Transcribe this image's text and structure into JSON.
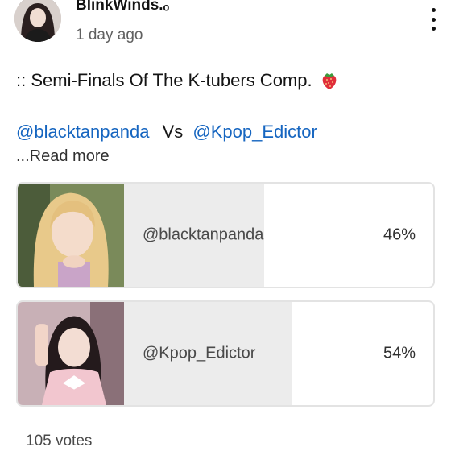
{
  "post": {
    "author": "BlinkWinds.ₒ",
    "timestamp": "1 day ago",
    "line1": ":: Semi-Finals Of The K-tubers Comp.",
    "emoji": "strawberry-icon",
    "mention_a": "@blacktanpanda",
    "vs": "Vs",
    "mention_b": "@Kpop_Edictor",
    "read_more": "...Read more"
  },
  "poll": {
    "options": [
      {
        "label": "@blacktanpanda",
        "percent_text": "46%",
        "percent": 46
      },
      {
        "label": "@Kpop_Edictor",
        "percent_text": "54%",
        "percent": 54
      }
    ],
    "votes": "105 votes"
  },
  "colors": {
    "accent": "#1565c0",
    "bar_fill": "#ececec",
    "border": "#e3e3e3"
  }
}
